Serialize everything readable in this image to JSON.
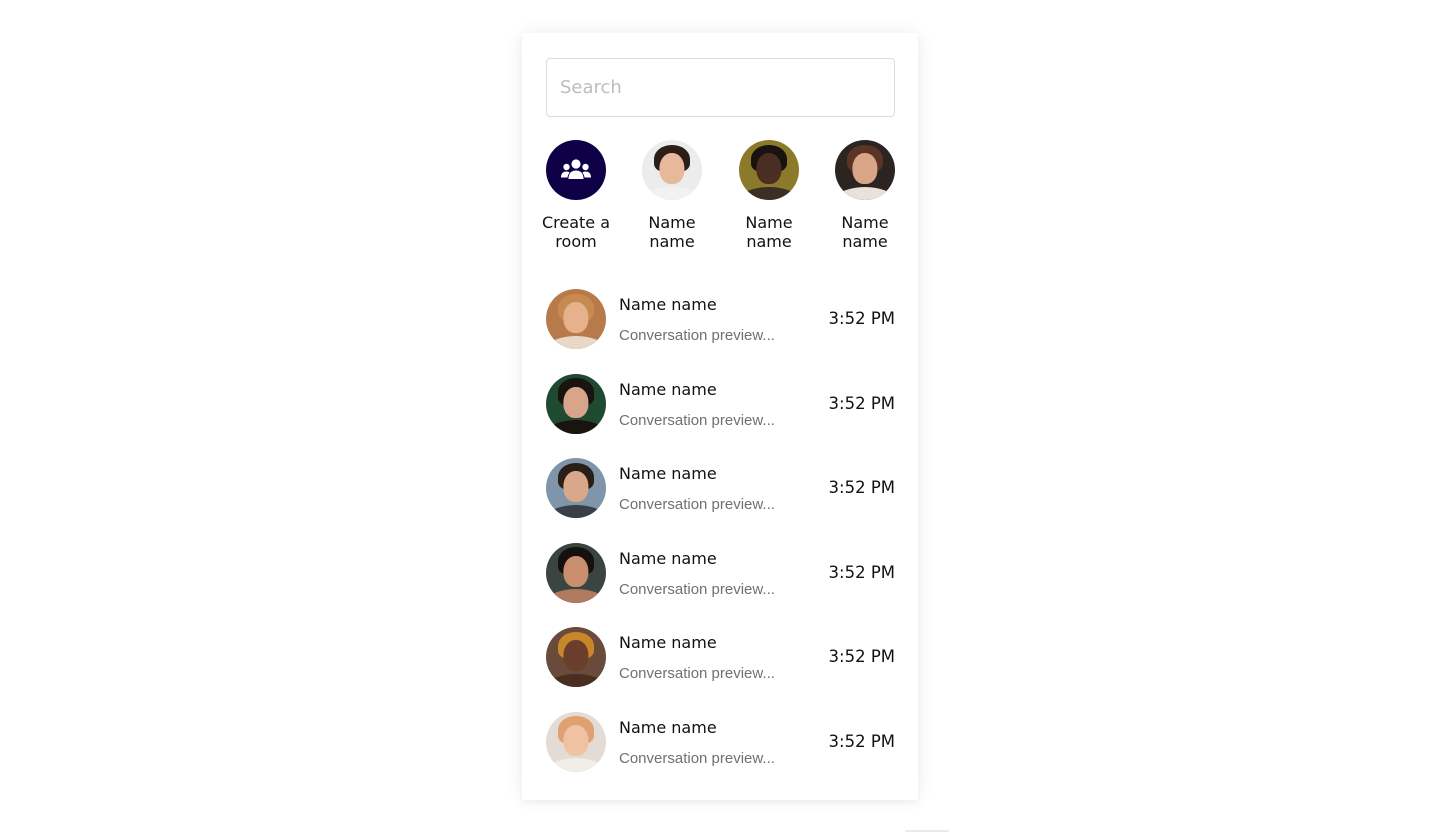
{
  "search": {
    "placeholder": "Search",
    "value": ""
  },
  "stories": [
    {
      "label": "Create a room",
      "icon": "users-icon",
      "accent": "#0d0047"
    },
    {
      "label": "Name name",
      "photo": {
        "bg": "#ececec",
        "skin": "#e8b89a",
        "hair": "#2a1e18",
        "cloth": "#f2f2f2"
      }
    },
    {
      "label": "Name name",
      "photo": {
        "bg": "#8a7a2a",
        "skin": "#4a2e22",
        "hair": "#1a120e",
        "cloth": "#3a2e26"
      }
    },
    {
      "label": "Name name",
      "photo": {
        "bg": "#2c2420",
        "skin": "#d9a587",
        "hair": "#5a3526",
        "cloth": "#e9e2da"
      }
    }
  ],
  "conversations": [
    {
      "name": "Name name",
      "preview": "Conversation preview...",
      "time": "3:52 PM",
      "photo": {
        "bg": "#b87a4a",
        "skin": "#e6b28e",
        "hair": "#c98a52",
        "cloth": "#e8d8c8"
      }
    },
    {
      "name": "Name name",
      "preview": "Conversation preview...",
      "time": "3:52 PM",
      "photo": {
        "bg": "#1e4a32",
        "skin": "#d8a58a",
        "hair": "#1a1410",
        "cloth": "#1a1410"
      }
    },
    {
      "name": "Name name",
      "preview": "Conversation preview...",
      "time": "3:52 PM",
      "photo": {
        "bg": "#7f95aa",
        "skin": "#d9a88a",
        "hair": "#2a1e18",
        "cloth": "#3a3e46"
      }
    },
    {
      "name": "Name name",
      "preview": "Conversation preview...",
      "time": "3:52 PM",
      "photo": {
        "bg": "#3a4440",
        "skin": "#c98e6e",
        "hair": "#15110e",
        "cloth": "#b07a5e"
      }
    },
    {
      "name": "Name name",
      "preview": "Conversation preview...",
      "time": "3:52 PM",
      "photo": {
        "bg": "#6a4a3a",
        "skin": "#6a3e2a",
        "hair": "#c8862a",
        "cloth": "#4a2e22"
      }
    },
    {
      "name": "Name name",
      "preview": "Conversation preview...",
      "time": "3:52 PM",
      "photo": {
        "bg": "#e2dcd4",
        "skin": "#efc2a4",
        "hair": "#e0a070",
        "cloth": "#f2ece6"
      }
    }
  ]
}
